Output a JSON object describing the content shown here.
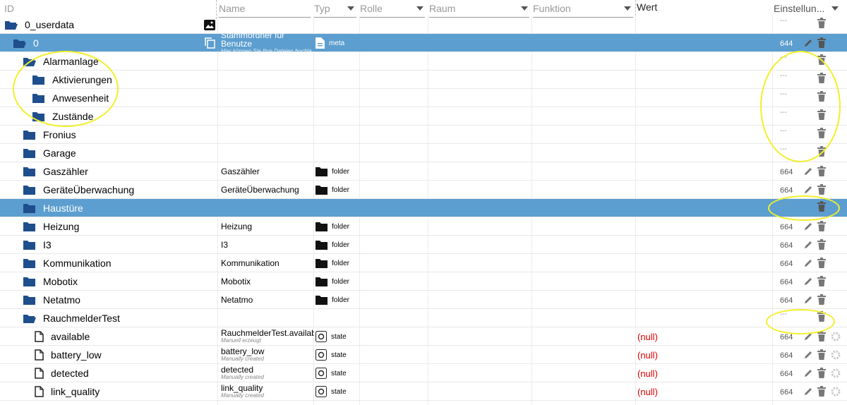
{
  "header": {
    "id": "ID",
    "name": "Name",
    "typ": "Typ",
    "rolle": "Rolle",
    "raum": "Raum",
    "funktion": "Funktion",
    "wert": "Wert",
    "einstellungen": "Einstellun..."
  },
  "rows": [
    {
      "id": "0_userdata",
      "indent": 0,
      "icon": "folder-open",
      "name": "",
      "sub": "",
      "type": "",
      "acl": "---",
      "extra": "image-icon"
    },
    {
      "id": "0",
      "indent": 1,
      "icon": "folder-open",
      "name": "Stammordner für Benutze",
      "sub": "Hier können Sie Ihre Dateien hochla",
      "type": "meta",
      "acl": "644",
      "extra": "copy-icon",
      "highlight": true
    },
    {
      "id": "Alarmanlage",
      "indent": 2,
      "icon": "folder-open",
      "name": "",
      "sub": "",
      "type": "",
      "acl": "---"
    },
    {
      "id": "Aktivierungen",
      "indent": 3,
      "icon": "folder",
      "name": "",
      "sub": "",
      "type": "",
      "acl": "---"
    },
    {
      "id": "Anwesenheit",
      "indent": 3,
      "icon": "folder",
      "name": "",
      "sub": "",
      "type": "",
      "acl": "---"
    },
    {
      "id": "Zustände",
      "indent": 3,
      "icon": "folder",
      "name": "",
      "sub": "",
      "type": "",
      "acl": "---"
    },
    {
      "id": "Fronius",
      "indent": 2,
      "icon": "folder",
      "name": "",
      "sub": "",
      "type": "",
      "acl": "---"
    },
    {
      "id": "Garage",
      "indent": 2,
      "icon": "folder",
      "name": "",
      "sub": "",
      "type": "",
      "acl": "---"
    },
    {
      "id": "Gaszähler",
      "indent": 2,
      "icon": "folder",
      "name": "Gaszähler",
      "sub": "",
      "type": "folder",
      "acl": "664"
    },
    {
      "id": "GeräteÜberwachung",
      "indent": 2,
      "icon": "folder",
      "name": "GeräteÜberwachung",
      "sub": "",
      "type": "folder",
      "acl": "664"
    },
    {
      "id": "Haustüre",
      "indent": 2,
      "icon": "folder",
      "name": "",
      "sub": "",
      "type": "",
      "acl": "---",
      "highlight2": true
    },
    {
      "id": "Heizung",
      "indent": 2,
      "icon": "folder",
      "name": "Heizung",
      "sub": "",
      "type": "folder",
      "acl": "664"
    },
    {
      "id": "I3",
      "indent": 2,
      "icon": "folder",
      "name": "I3",
      "sub": "",
      "type": "folder",
      "acl": "664"
    },
    {
      "id": "Kommunikation",
      "indent": 2,
      "icon": "folder",
      "name": "Kommunikation",
      "sub": "",
      "type": "folder",
      "acl": "664"
    },
    {
      "id": "Mobotix",
      "indent": 2,
      "icon": "folder",
      "name": "Mobotix",
      "sub": "",
      "type": "folder",
      "acl": "664"
    },
    {
      "id": "Netatmo",
      "indent": 2,
      "icon": "folder",
      "name": "Netatmo",
      "sub": "",
      "type": "folder",
      "acl": "664"
    },
    {
      "id": "RauchmelderTest",
      "indent": 2,
      "icon": "folder-open",
      "name": "",
      "sub": "",
      "type": "",
      "acl": "---"
    },
    {
      "id": "available",
      "indent": 3,
      "icon": "file",
      "name": "RauchmelderTest.available",
      "sub": "Manuell erzeugt",
      "type": "state",
      "value": "(null)",
      "acl": "664",
      "gear": true
    },
    {
      "id": "battery_low",
      "indent": 3,
      "icon": "file",
      "name": "battery_low",
      "sub": "Manually created",
      "type": "state",
      "value": "(null)",
      "acl": "664",
      "gear": true
    },
    {
      "id": "detected",
      "indent": 3,
      "icon": "file",
      "name": "detected",
      "sub": "Manually created",
      "type": "state",
      "value": "(null)",
      "acl": "664",
      "gear": true
    },
    {
      "id": "link_quality",
      "indent": 3,
      "icon": "file",
      "name": "link_quality",
      "sub": "Manually created",
      "type": "state",
      "value": "(null)",
      "acl": "664",
      "gear": true
    }
  ],
  "colors": {
    "highlight": "#5c9ecf",
    "folder": "#1f4e8c",
    "annotation": "#f2ef2a",
    "null_value": "#d00000"
  }
}
